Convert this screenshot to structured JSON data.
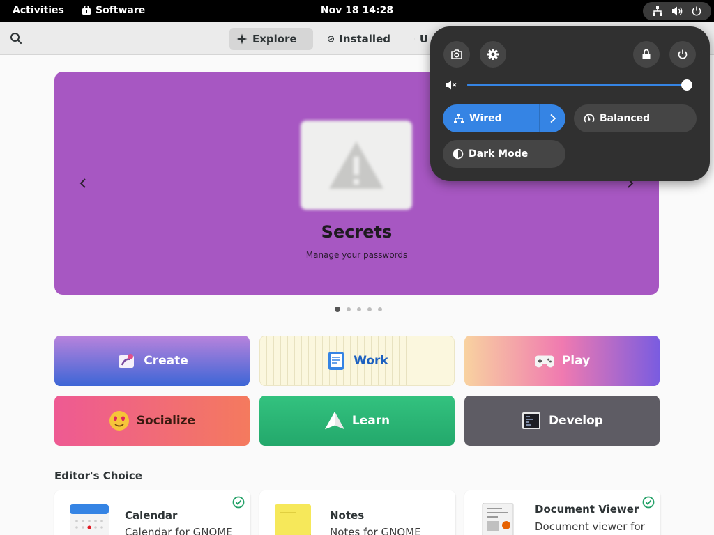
{
  "topbar": {
    "activities": "Activities",
    "app_name": "Software",
    "clock": "Nov 18  14:28"
  },
  "header": {
    "tabs": [
      {
        "label": "Explore",
        "icon": "explore-icon",
        "active": true
      },
      {
        "label": "Installed",
        "icon": "check-circle-icon",
        "active": false
      },
      {
        "label": "U",
        "icon": "refresh-icon",
        "active": false
      }
    ]
  },
  "featured": {
    "title": "Secrets",
    "subtitle": "Manage your passwords",
    "background": "#a757c2",
    "page_count": 5,
    "active_page": 1
  },
  "categories": [
    {
      "label": "Create",
      "icon": "create-icon"
    },
    {
      "label": "Work",
      "icon": "work-icon"
    },
    {
      "label": "Play",
      "icon": "gamepad-icon"
    },
    {
      "label": "Socialize",
      "icon": "emoji-icon"
    },
    {
      "label": "Learn",
      "icon": "paper-plane-icon"
    },
    {
      "label": "Develop",
      "icon": "terminal-icon"
    }
  ],
  "editors_choice": {
    "title": "Editor's Choice",
    "apps": [
      {
        "name": "Calendar",
        "description": "Calendar for GNOME",
        "installed": true
      },
      {
        "name": "Notes",
        "description": "Notes for GNOME",
        "installed": false
      },
      {
        "name": "Document Viewer",
        "description": "Document viewer for",
        "installed": true
      }
    ]
  },
  "quick_settings": {
    "volume_level": 1.0,
    "volume_muted_icon": true,
    "network_label": "Wired",
    "power_mode_label": "Balanced",
    "dark_mode_label": "Dark Mode",
    "accent": "#3584e4"
  }
}
